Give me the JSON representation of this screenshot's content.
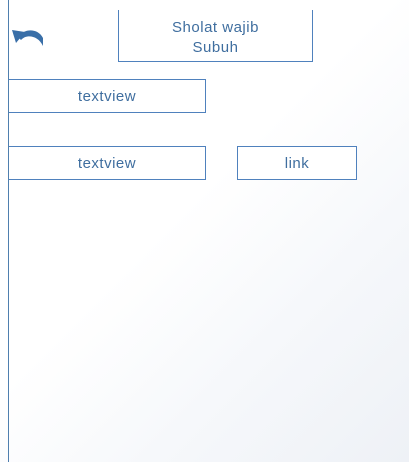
{
  "header": {
    "title_line1": "Sholat wajib",
    "title_line2": "Subuh",
    "back_icon": "undo-arrow-icon"
  },
  "content": {
    "textview_1": "textview",
    "textview_2": "textview",
    "link_label": "link"
  },
  "colors": {
    "accent": "#4f81bd",
    "text": "#3f6e9f"
  }
}
